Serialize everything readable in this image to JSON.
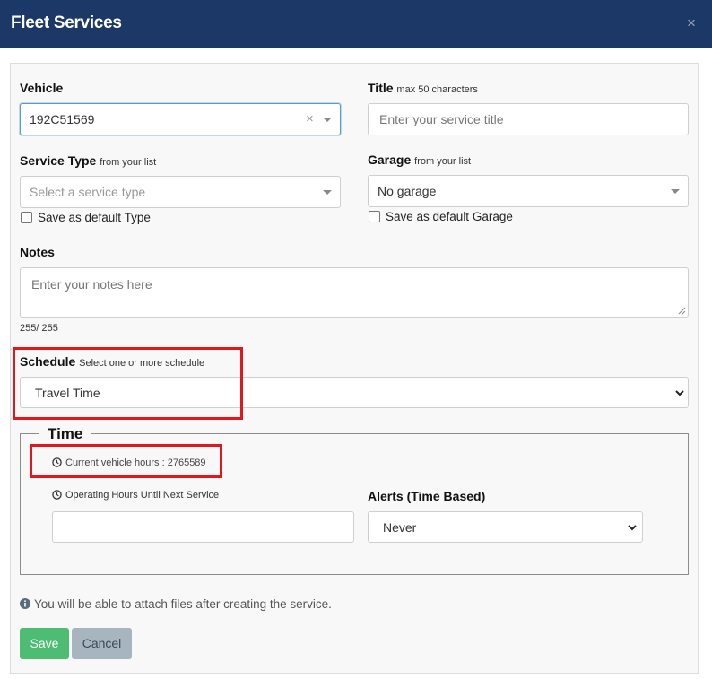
{
  "header": {
    "title": "Fleet Services",
    "close_symbol": "×"
  },
  "vehicle": {
    "label": "Vehicle",
    "value": "192C51569",
    "clear_symbol": "×"
  },
  "title_field": {
    "label": "Title",
    "hint": "max 50 characters",
    "placeholder": "Enter your service title"
  },
  "service_type": {
    "label": "Service Type",
    "hint": "from your list",
    "placeholder": "Select a service type",
    "default_checkbox_label": "Save as default Type"
  },
  "garage": {
    "label": "Garage",
    "hint": "from your list",
    "value": "No garage",
    "default_checkbox_label": "Save as default Garage"
  },
  "notes": {
    "label": "Notes",
    "placeholder": "Enter your notes here",
    "counter": "255/ 255"
  },
  "schedule": {
    "label": "Schedule",
    "hint": "Select one or more schedule",
    "value": "Travel Time"
  },
  "time_section": {
    "legend": "Time",
    "current_hours": "Current vehicle hours : 2765589",
    "operating_hours_label": "Operating Hours Until Next Service",
    "alerts_label": "Alerts (Time Based)",
    "alerts_value": "Never"
  },
  "info_message": "You will be able to attach files after creating the service.",
  "buttons": {
    "save": "Save",
    "cancel": "Cancel"
  },
  "colors": {
    "header": "#1c3866",
    "highlight": "#e3151d",
    "save": "#4dbd74",
    "cancel": "#a7b5be"
  }
}
